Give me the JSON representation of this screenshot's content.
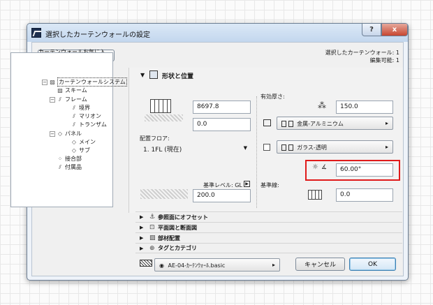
{
  "window": {
    "title": "選択したカーテンウォールの設定",
    "help_label": "?",
    "close_label": "x"
  },
  "favorites_button": "カーテンウォールお気に入り...",
  "selection_info": {
    "line1": "選択したカーテンウォール: 1",
    "line2": "編集可能: 1"
  },
  "tree": {
    "root": "カーテンウォールシステム",
    "items": [
      {
        "label": "スキーム",
        "level": 1
      },
      {
        "label": "フレーム",
        "level": 1
      },
      {
        "label": "境界",
        "level": 2
      },
      {
        "label": "マリオン",
        "level": 2
      },
      {
        "label": "トランザム",
        "level": 2
      },
      {
        "label": "パネル",
        "level": 1
      },
      {
        "label": "メイン",
        "level": 2
      },
      {
        "label": "サブ",
        "level": 2
      },
      {
        "label": "接合部",
        "level": 1
      },
      {
        "label": "付属品",
        "level": 1
      }
    ]
  },
  "shape": {
    "section_title": "形状と位置",
    "height_value": "8697.8",
    "offset_value": "0.0",
    "floor_label": "配置フロア:",
    "floor_value": "1. 1FL (現在)",
    "ref_level_label": "基準レベル: GL",
    "ref_level_value": "200.0",
    "thickness_label": "有効厚さ:",
    "thickness_value": "150.0",
    "frame_material": "金属-アルミニウム",
    "panel_material": "ガラス-透明",
    "angle_value": "60.00°",
    "baseline_label": "基準線:",
    "baseline_value": "0.0"
  },
  "collapsed_sections": [
    {
      "label": "参照面にオフセット",
      "icon": "offset-icon"
    },
    {
      "label": "平面図と断面図",
      "icon": "plan-section-icon"
    },
    {
      "label": "部材配置",
      "icon": "member-placement-icon"
    },
    {
      "label": "タグとカテゴリ",
      "icon": "tag-category-icon"
    }
  ],
  "footer": {
    "layer_value": "AE-04-ｶｰﾃﾝｳｫｰﾙ.basic",
    "cancel_label": "キャンセル",
    "ok_label": "OK"
  },
  "colors": {
    "highlight": "#e01b1b",
    "ok_border": "#3c7fb1"
  }
}
